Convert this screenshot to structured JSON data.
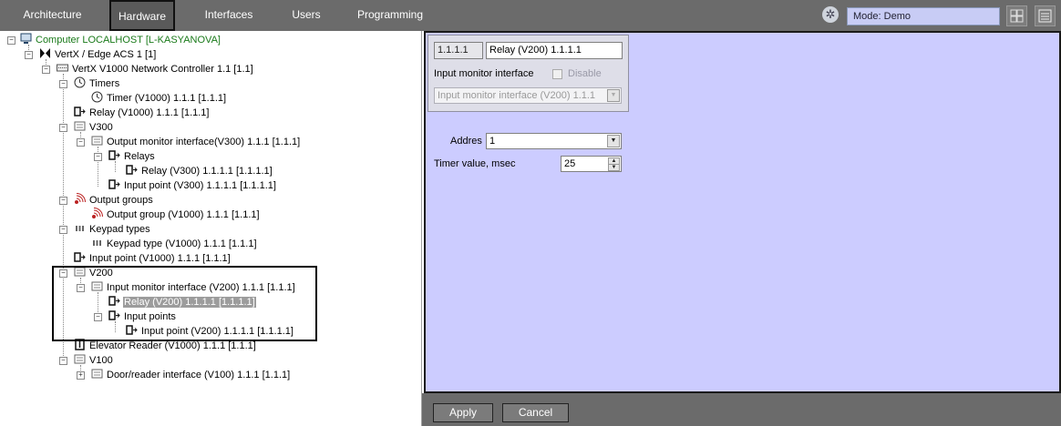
{
  "nav": {
    "tabs": [
      "Architecture",
      "Hardware",
      "Interfaces",
      "Users",
      "Programming"
    ],
    "active_tab": "Hardware",
    "mode": "Mode: Demo"
  },
  "tree": [
    "Computer LOCALHOST [L-KASYANOVA]",
    "VertX / Edge ACS 1 [1]",
    "VertX V1000 Network Controller 1.1 [1.1]",
    "Timers",
    "Timer (V1000) 1.1.1 [1.1.1]",
    "Relay (V1000) 1.1.1 [1.1.1]",
    "V300",
    "Output monitor interface(V300) 1.1.1 [1.1.1]",
    "Relays",
    "Relay (V300) 1.1.1.1 [1.1.1.1]",
    "Input point (V300) 1.1.1.1 [1.1.1.1]",
    "Output groups",
    "Output group (V1000) 1.1.1 [1.1.1]",
    "Keypad types",
    "Keypad type (V1000) 1.1.1 [1.1.1]",
    "Input point (V1000) 1.1.1 [1.1.1]",
    "V200",
    "Input monitor interface (V200) 1.1.1 [1.1.1]",
    "Relay (V200) 1.1.1.1 [1.1.1.1]",
    "Input points",
    "Input point (V200) 1.1.1.1 [1.1.1.1]",
    "Elevator Reader (V1000) 1.1.1 [1.1.1]",
    "V100",
    "Door/reader interface (V100) 1.1.1 [1.1.1]"
  ],
  "selected_item": "Relay (V200) 1.1.1.1 [1.1.1.1]",
  "properties": {
    "id": "1.1.1.1",
    "name": "Relay (V200) 1.1.1.1",
    "parent_label": "Input monitor interface",
    "disable_label": "Disable",
    "disable_checked": false,
    "parent_value": "Input monitor interface (V200) 1.1.1",
    "address_label": "Addres",
    "address_value": "1",
    "timer_label": "Timer value, msec",
    "timer_value": "25"
  },
  "buttons": {
    "apply": "Apply",
    "cancel": "Cancel"
  }
}
